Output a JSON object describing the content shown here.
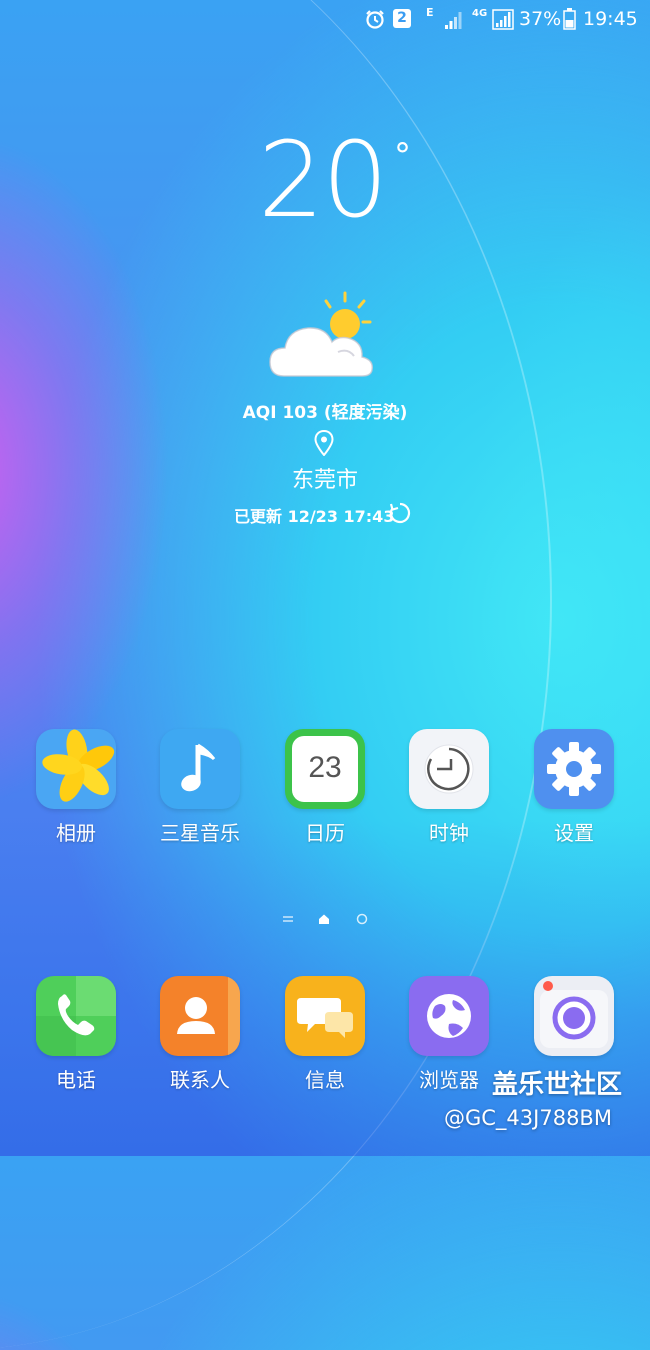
{
  "status_bar": {
    "alarm_icon": "alarm-clock-icon",
    "notification_count": "2",
    "network_e": "E",
    "network_4g": "4G",
    "battery_percent": "37%",
    "time": "19:45"
  },
  "weather": {
    "temperature": "20",
    "degree_symbol": "°",
    "condition_icon": "partly-cloudy-icon",
    "aqi": "AQI 103 (轻度污染)",
    "city": "东莞市",
    "updated": "已更新 12/23 17:43"
  },
  "apps": [
    {
      "label": "相册",
      "icon": "gallery-icon"
    },
    {
      "label": "三星音乐",
      "icon": "music-note-icon"
    },
    {
      "label": "日历",
      "icon": "calendar-icon",
      "date": "23"
    },
    {
      "label": "时钟",
      "icon": "clock-icon"
    },
    {
      "label": "设置",
      "icon": "gear-icon"
    }
  ],
  "dock": [
    {
      "label": "电话",
      "icon": "phone-icon"
    },
    {
      "label": "联系人",
      "icon": "contacts-icon"
    },
    {
      "label": "信息",
      "icon": "messages-icon"
    },
    {
      "label": "浏览器",
      "icon": "browser-icon"
    },
    {
      "label": "",
      "icon": "camera-icon"
    }
  ],
  "pager": {
    "current_page": 2,
    "total_pages": 3
  },
  "watermark": {
    "site": "盖乐世社区",
    "user": "@GC_43J788BM"
  },
  "colors": {
    "gallery": "#4aa6f3",
    "music": "#3ea8f2",
    "calendar_border": "#3cc34a",
    "settings": "#4f90ef",
    "phone": "#4fcf5a",
    "contacts": "#f4822a",
    "messages": "#f8b21c",
    "browser": "#8a6cf0"
  }
}
